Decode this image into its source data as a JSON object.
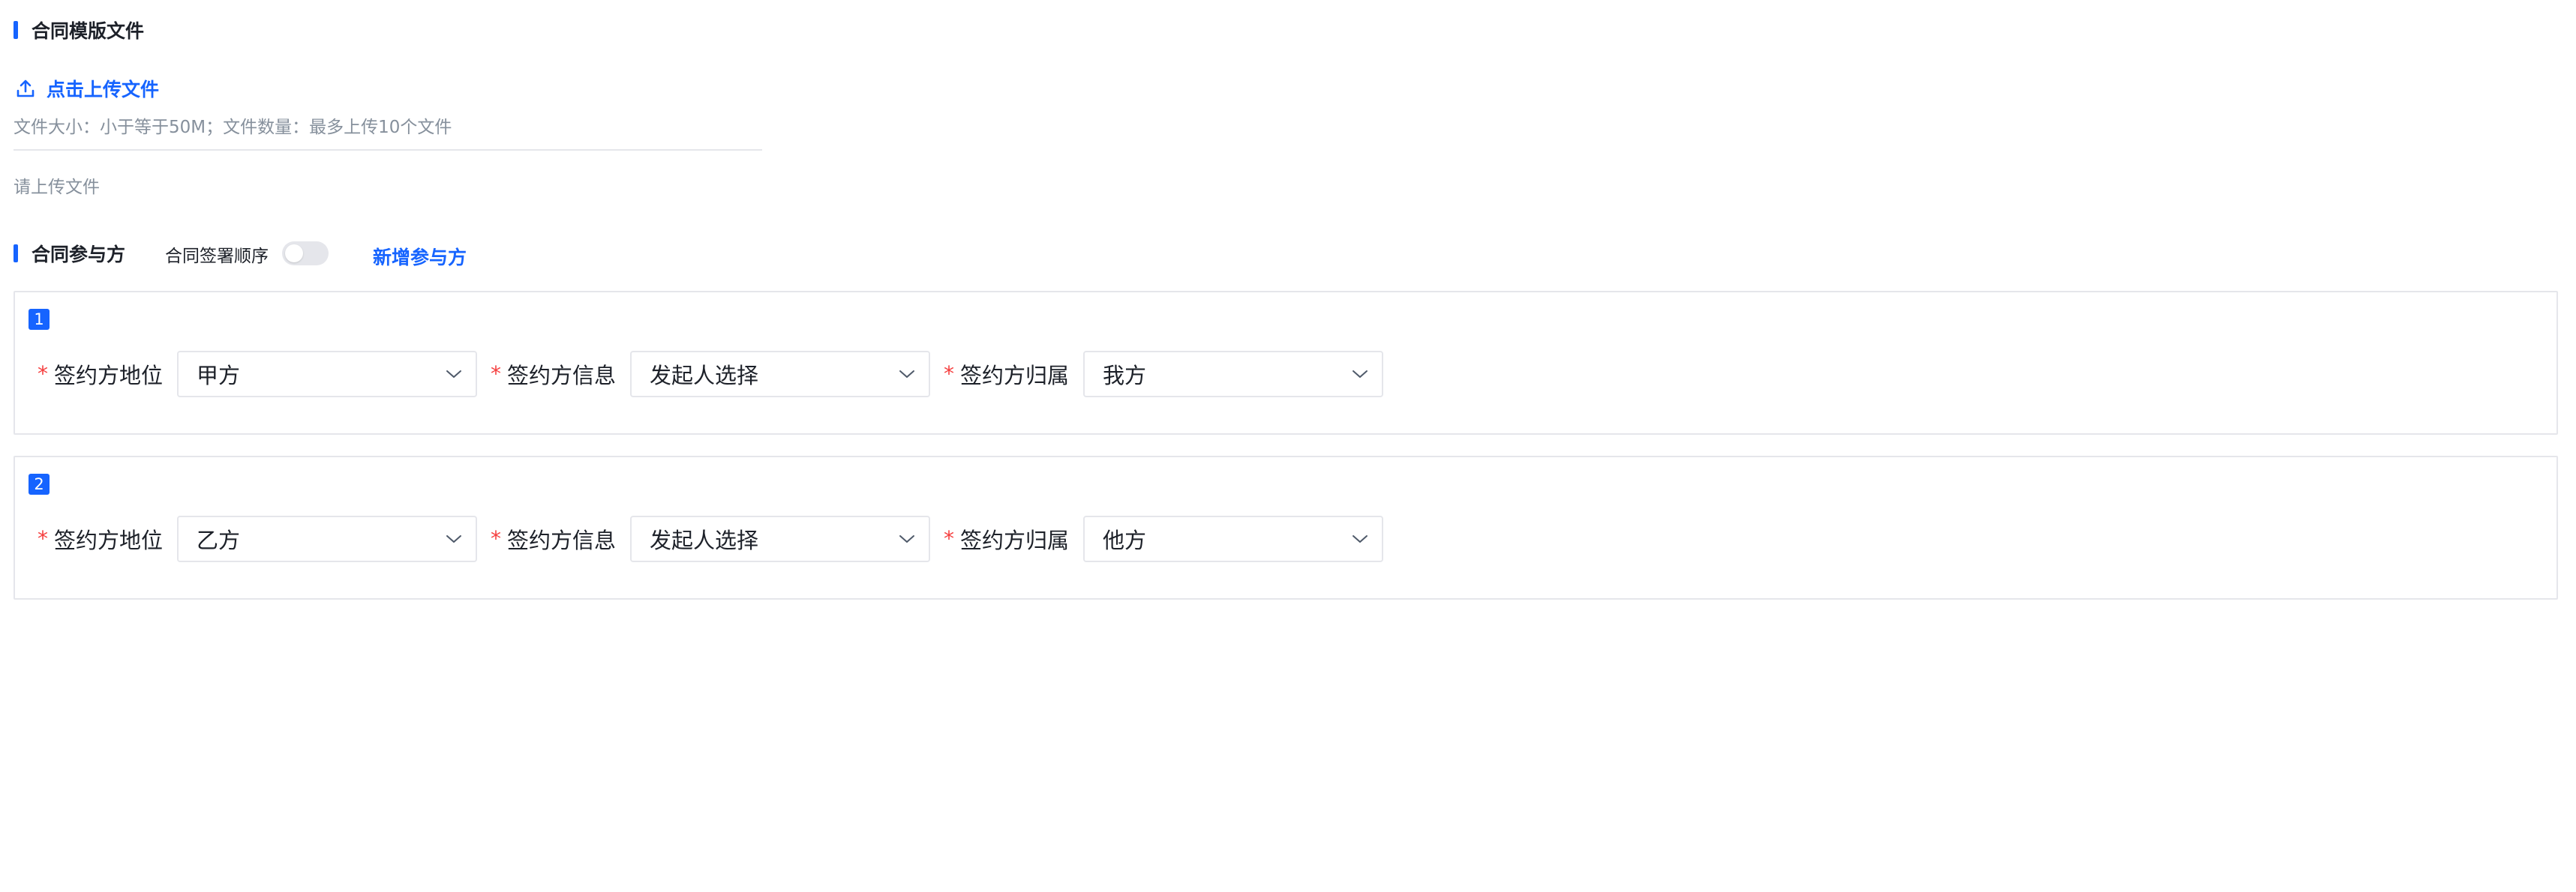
{
  "template_section": {
    "title": "合同模版文件",
    "upload_label": "点击上传文件",
    "hint": "文件大小：小于等于50M；文件数量：最多上传10个文件",
    "empty_text": "请上传文件"
  },
  "participants_section": {
    "title": "合同参与方",
    "order_label": "合同签署顺序",
    "order_enabled": false,
    "add_label": "新增参与方"
  },
  "parties": [
    {
      "index": "1",
      "fields": [
        {
          "label": "签约方地位",
          "value": "甲方"
        },
        {
          "label": "签约方信息",
          "value": "发起人选择"
        },
        {
          "label": "签约方归属",
          "value": "我方"
        }
      ]
    },
    {
      "index": "2",
      "fields": [
        {
          "label": "签约方地位",
          "value": "乙方"
        },
        {
          "label": "签约方信息",
          "value": "发起人选择"
        },
        {
          "label": "签约方归属",
          "value": "他方"
        }
      ]
    }
  ],
  "icons": {
    "upload": "upload-icon",
    "dropdown": "chevron-down-icon"
  },
  "colors": {
    "accent": "#1664ff",
    "required": "#f53f3f",
    "border": "#e5e6eb",
    "muted_text": "#86909c"
  }
}
